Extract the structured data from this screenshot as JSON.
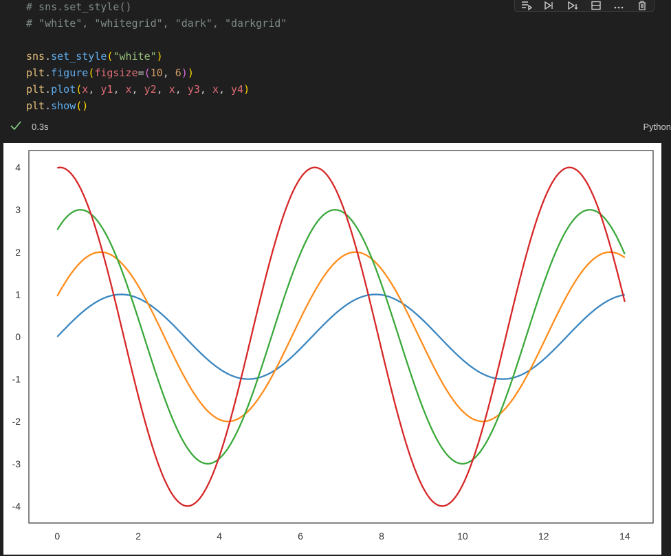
{
  "code": {
    "lines": [
      [
        {
          "t": "# sns.set_style()",
          "c": "c-comment"
        }
      ],
      [
        {
          "t": "# \"white\", \"whitegrid\", \"dark\", \"darkgrid\"",
          "c": "c-comment"
        }
      ],
      [],
      [
        {
          "t": "sns",
          "c": "c-mod"
        },
        {
          "t": ".",
          "c": "c-punc"
        },
        {
          "t": "set_style",
          "c": "c-fn"
        },
        {
          "t": "(",
          "c": "c-paren"
        },
        {
          "t": "\"white\"",
          "c": "c-str"
        },
        {
          "t": ")",
          "c": "c-paren"
        }
      ],
      [
        {
          "t": "plt",
          "c": "c-mod"
        },
        {
          "t": ".",
          "c": "c-punc"
        },
        {
          "t": "figure",
          "c": "c-fn"
        },
        {
          "t": "(",
          "c": "c-paren"
        },
        {
          "t": "figsize",
          "c": "c-kw"
        },
        {
          "t": "=",
          "c": "c-punc"
        },
        {
          "t": "(",
          "c": "c-paren2"
        },
        {
          "t": "10",
          "c": "c-num"
        },
        {
          "t": ", ",
          "c": "c-punc"
        },
        {
          "t": "6",
          "c": "c-num"
        },
        {
          "t": ")",
          "c": "c-paren2"
        },
        {
          "t": ")",
          "c": "c-paren"
        }
      ],
      [
        {
          "t": "plt",
          "c": "c-mod"
        },
        {
          "t": ".",
          "c": "c-punc"
        },
        {
          "t": "plot",
          "c": "c-fn"
        },
        {
          "t": "(",
          "c": "c-paren"
        },
        {
          "t": "x",
          "c": "c-kw"
        },
        {
          "t": ", ",
          "c": "c-punc"
        },
        {
          "t": "y1",
          "c": "c-kw"
        },
        {
          "t": ", ",
          "c": "c-punc"
        },
        {
          "t": "x",
          "c": "c-kw"
        },
        {
          "t": ", ",
          "c": "c-punc"
        },
        {
          "t": "y2",
          "c": "c-kw"
        },
        {
          "t": ", ",
          "c": "c-punc"
        },
        {
          "t": "x",
          "c": "c-kw"
        },
        {
          "t": ", ",
          "c": "c-punc"
        },
        {
          "t": "y3",
          "c": "c-kw"
        },
        {
          "t": ", ",
          "c": "c-punc"
        },
        {
          "t": "x",
          "c": "c-kw"
        },
        {
          "t": ", ",
          "c": "c-punc"
        },
        {
          "t": "y4",
          "c": "c-kw"
        },
        {
          "t": ")",
          "c": "c-paren"
        }
      ],
      [
        {
          "t": "plt",
          "c": "c-mod"
        },
        {
          "t": ".",
          "c": "c-punc"
        },
        {
          "t": "show",
          "c": "c-fn"
        },
        {
          "t": "()",
          "c": "c-paren"
        }
      ]
    ]
  },
  "toolbar": {
    "icons": [
      "run-by-line-icon",
      "execute-above-icon",
      "execute-below-icon",
      "split-cell-icon",
      "more-actions-icon",
      "delete-cell-icon"
    ]
  },
  "status": {
    "check_icon": "checkmark-icon",
    "duration": "0.3s",
    "language": "Python"
  },
  "chart_data": {
    "type": "line",
    "title": "",
    "xlabel": "",
    "ylabel": "",
    "xlim": [
      -0.7,
      14.7
    ],
    "ylim": [
      -4.4,
      4.4
    ],
    "xticks": [
      "0",
      "2",
      "4",
      "6",
      "8",
      "10",
      "12",
      "14"
    ],
    "yticks": [
      "-4",
      "-3",
      "-2",
      "-1",
      "0",
      "1",
      "2",
      "3",
      "4"
    ],
    "grid": false,
    "x_range": [
      0,
      14
    ],
    "series": [
      {
        "formula": "1*sin(x)",
        "amplitude": 1,
        "phase": 0,
        "color": "#3a86c0",
        "points": [
          [
            0,
            0
          ],
          [
            1.57,
            1
          ],
          [
            4.71,
            -1
          ],
          [
            7.85,
            1
          ],
          [
            11.0,
            -1
          ],
          [
            14,
            0.99
          ]
        ]
      },
      {
        "formula": "2*sin(x+0.5)",
        "amplitude": 2,
        "phase": 0.5,
        "color": "#ff8c1a",
        "points": [
          [
            0,
            0.96
          ],
          [
            1.07,
            2
          ],
          [
            4.21,
            -2
          ],
          [
            7.35,
            2
          ],
          [
            10.5,
            -2
          ],
          [
            14,
            1.87
          ]
        ]
      },
      {
        "formula": "3*sin(x+1)",
        "amplitude": 3,
        "phase": 1,
        "color": "#3aa83a",
        "points": [
          [
            0,
            2.52
          ],
          [
            0.57,
            3
          ],
          [
            3.71,
            -3
          ],
          [
            6.85,
            3
          ],
          [
            10.0,
            -3
          ],
          [
            14,
            1.95
          ]
        ]
      },
      {
        "formula": "4*sin(x+1.5)",
        "amplitude": 4,
        "phase": 1.5,
        "color": "#d62728",
        "points": [
          [
            0,
            3.99
          ],
          [
            0.07,
            4
          ],
          [
            3.21,
            -4
          ],
          [
            6.35,
            4
          ],
          [
            9.5,
            -4
          ],
          [
            14,
            0.84
          ]
        ]
      }
    ]
  }
}
